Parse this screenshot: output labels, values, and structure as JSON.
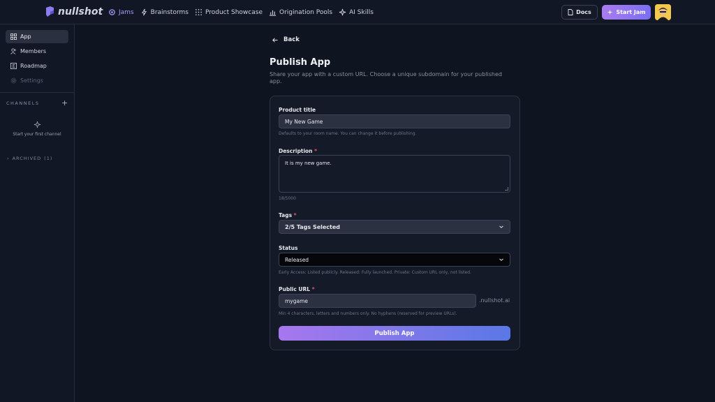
{
  "brand": {
    "name": "nullshot"
  },
  "nav": [
    {
      "label": "Jams",
      "icon": "jams-icon",
      "active": true
    },
    {
      "label": "Brainstorms",
      "icon": "lightning-icon"
    },
    {
      "label": "Product Showcase",
      "icon": "grid-icon"
    },
    {
      "label": "Origination Pools",
      "icon": "chart-icon"
    },
    {
      "label": "AI Skills",
      "icon": "sparkle-icon"
    }
  ],
  "header": {
    "docs_label": "Docs",
    "start_label": "Start Jam"
  },
  "sidebar": {
    "items": [
      {
        "label": "App",
        "icon": "grid-icon"
      },
      {
        "label": "Members",
        "icon": "users-icon"
      },
      {
        "label": "Roadmap",
        "icon": "roadmap-icon"
      },
      {
        "label": "Settings",
        "icon": "gear-icon"
      }
    ],
    "channels_label": "CHANNELS",
    "channels_empty": "Start your first channel",
    "archived_label": "ARCHIVED",
    "archived_count": "(1)"
  },
  "main": {
    "back_label": "Back",
    "title": "Publish App",
    "subtitle": "Share your app with a custom URL. Choose a unique subdomain for your published app.",
    "product_title_label": "Product title",
    "product_title_value": "My New Game",
    "product_title_help": "Defaults to your room name. You can change it before publishing.",
    "description_label": "Description",
    "description_value": "It is my new game.",
    "description_count": "18/5000",
    "tags_label": "Tags",
    "tags_value": "2/5 Tags Selected",
    "status_label": "Status",
    "status_value": "Released",
    "status_help": "Early Access: Listed publicly. Released: Fully launched. Private: Custom URL only, not listed.",
    "url_label": "Public URL",
    "url_value": "mygame",
    "url_suffix": ".nullshot.ai",
    "url_help": "Min 4 characters, letters and numbers only. No hyphens (reserved for preview URLs).",
    "required_mark": "*",
    "publish_label": "Publish App"
  },
  "colors": {
    "accent": "#a89cf5",
    "required": "#e0556b"
  }
}
